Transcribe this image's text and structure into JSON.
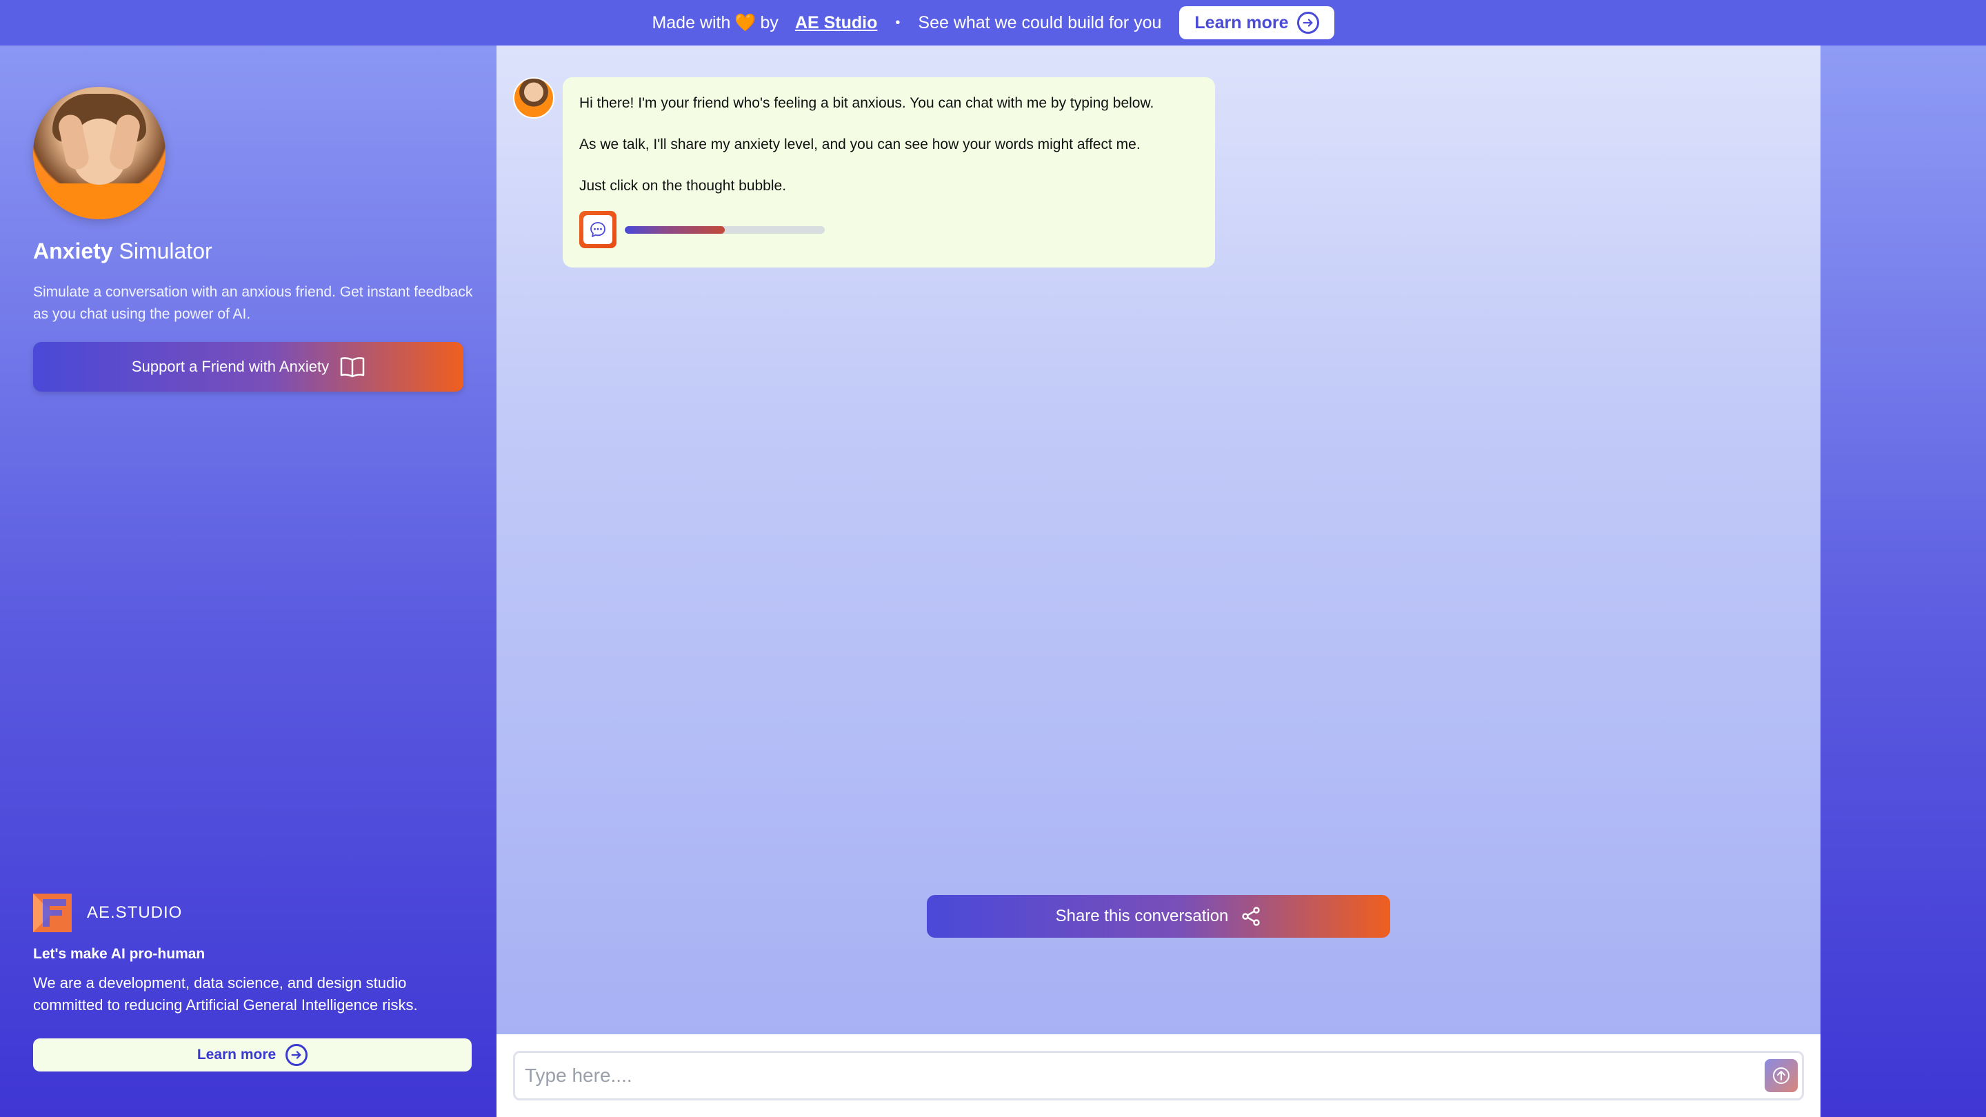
{
  "banner": {
    "made_with": "Made with",
    "heart": "🧡",
    "by": "by",
    "brand": "AE Studio",
    "separator": "•",
    "tagline": "See what we could build for you",
    "learn_more": "Learn more"
  },
  "sidebar": {
    "title_bold": "Anxiety",
    "title_rest": "Simulator",
    "description": "Simulate a conversation with an anxious friend. Get instant feedback as you chat using the power of AI.",
    "support_button": "Support a Friend with Anxiety",
    "logo_text": "AE.STUDIO",
    "tagline": "Let's make AI pro-human",
    "about": "We are a development, data science, and design studio committed to reducing Artificial General Intelligence risks.",
    "learn_more": "Learn more"
  },
  "chat": {
    "messages": [
      {
        "lines": [
          "Hi there! I'm your friend who's feeling a bit anxious. You can chat with me by typing below.",
          "As we talk, I'll share my anxiety level, and you can see how your words might affect me.",
          "Just click on the thought bubble."
        ],
        "anxiety_level": 0.5
      }
    ],
    "share_button": "Share this conversation"
  },
  "input": {
    "placeholder": "Type here...."
  },
  "colors": {
    "banner_bg": "#5960e6",
    "accent_blue": "#4a49d8",
    "accent_orange": "#ef5f1f",
    "bubble_bg": "#f4fde4"
  }
}
